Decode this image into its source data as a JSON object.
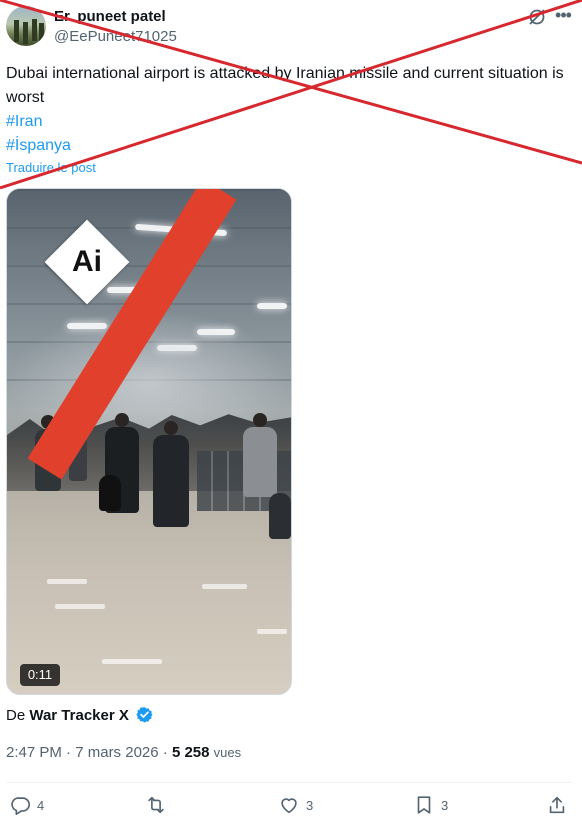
{
  "author": {
    "display_name": "Er. puneet patel",
    "handle": "@EePuneet71025"
  },
  "header_icons": [
    "grok-icon",
    "more-icon"
  ],
  "tweet": {
    "text": "Dubai international airport is attacked by Iranian missile and current situation is worst",
    "hashtags": [
      "#Iran",
      "#İspanya"
    ],
    "translate_label": "Traduire le post"
  },
  "media": {
    "badge": "Ai",
    "duration": "0:11"
  },
  "source": {
    "prefix": "De",
    "account": "War Tracker X",
    "verified": true
  },
  "meta": {
    "time": "2:47 PM",
    "separator": "·",
    "date": "7 mars 2026",
    "view_count": "5 258",
    "views_label": "vues"
  },
  "actions": {
    "replies": "4",
    "likes": "3",
    "bookmarks": "3"
  },
  "colors": {
    "accent": "#1d9bf0",
    "text": "#0f1419",
    "muted": "#536471",
    "strike": "#d7282f",
    "ai_band": "#e0402c"
  },
  "overlay": {
    "type": "red-x-strike"
  }
}
